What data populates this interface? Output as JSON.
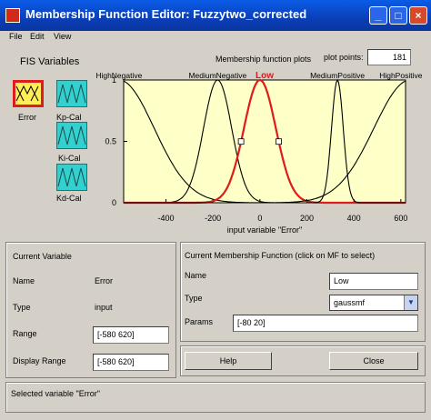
{
  "window": {
    "title": "Membership Function Editor: Fuzzytwo_corrected",
    "minimize": "_",
    "maximize": "□",
    "close": "×"
  },
  "menu": [
    "File",
    "Edit",
    "View"
  ],
  "fis": {
    "heading": "FIS Variables",
    "inputs": [
      {
        "name": "Error"
      }
    ],
    "outputs": [
      {
        "name": "Kp-Cal"
      },
      {
        "name": "Ki-Cal"
      },
      {
        "name": "Kd-Cal"
      }
    ]
  },
  "plot": {
    "title": "Membership function plots",
    "points_label": "plot points:",
    "points_value": "181",
    "xlabel": "input variable \"Error\"",
    "background": "#ffffc8"
  },
  "chart_data": {
    "type": "line",
    "xlim": [
      -580,
      620
    ],
    "ylim": [
      0,
      1
    ],
    "xticks": [
      -400,
      -200,
      0,
      200,
      400,
      600
    ],
    "yticks": [
      0,
      0.5,
      1
    ],
    "xlabel": "input variable \"Error\"",
    "selected": "Low",
    "series": [
      {
        "name": "HighNegative",
        "shape": "gaussmf",
        "params": [
          -620,
          200
        ],
        "color": "#000000"
      },
      {
        "name": "MediumNegative",
        "shape": "gaussmf",
        "params": [
          -180,
          60
        ],
        "color": "#000000"
      },
      {
        "name": "Low",
        "shape": "gaussmf",
        "params": [
          -80,
          20
        ],
        "color": "#e01b1b",
        "note": "drawn centered near 0 in the screenshot"
      },
      {
        "name": "MediumPositive",
        "shape": "gaussmf",
        "params": [
          330,
          18
        ],
        "color": "#000000"
      },
      {
        "name": "HighPositive",
        "shape": "gaussmf",
        "params": [
          640,
          220
        ],
        "color": "#000000"
      }
    ]
  },
  "current_variable": {
    "heading": "Current Variable",
    "name_label": "Name",
    "name_value": "Error",
    "type_label": "Type",
    "type_value": "input",
    "range_label": "Range",
    "range_value": "[-580 620]",
    "display_range_label": "Display Range",
    "display_range_value": "[-580 620]"
  },
  "current_mf": {
    "heading": "Current Membership Function (click on MF to select)",
    "name_label": "Name",
    "name_value": "Low",
    "type_label": "Type",
    "type_value": "gaussmf",
    "params_label": "Params",
    "params_value": "[-80 20]"
  },
  "buttons": {
    "help": "Help",
    "close": "Close"
  },
  "status": "Selected variable \"Error\""
}
